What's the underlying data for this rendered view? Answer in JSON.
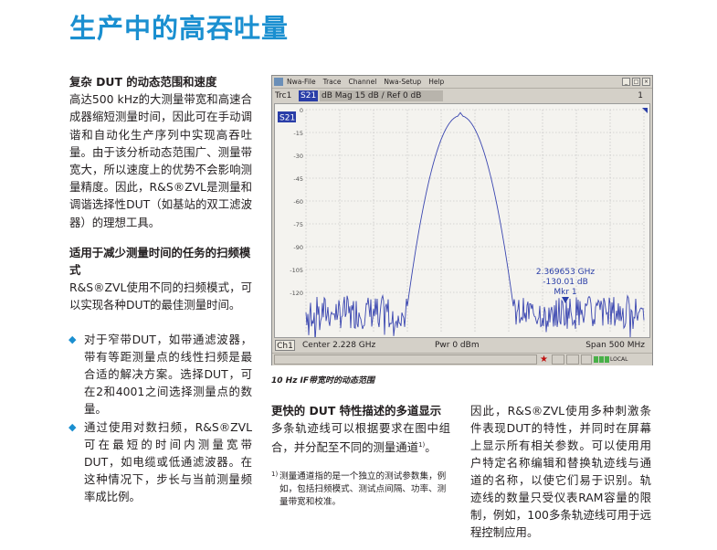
{
  "page": {
    "title": "生产中的高吞吐量"
  },
  "left_column": {
    "section1_heading": "复杂 DUT 的动态范围和速度",
    "section1_text": "高达500 kHz的大测量带宽和高速合成器缩短测量时间，因此可在手动调谐和自动化生产序列中实现高吞吐量。由于该分析动态范围广、测量带宽大，所以速度上的优势不会影响测量精度。因此，R&S®ZVL是测量和调谐选择性DUT（如基站的双工滤波器）的理想工具。",
    "section2_heading": "适用于减少测量时间的任务的扫频模式",
    "section2_text": "R&S®ZVL使用不同的扫频模式，可以实现各种DUT的最佳测量时间。",
    "bullets": [
      "对于窄带DUT，如带通滤波器，带有等距测量点的线性扫频是最合适的解决方案。选择DUT，可在2和4001之间选择测量点的数量。",
      "通过使用对数扫频，R&S®ZVL可在最短的时间内测量宽带DUT，如电缆或低通滤波器。在这种情况下，步长与当前测量频率成比例。"
    ]
  },
  "instrument": {
    "menu": [
      "Nwa-File",
      "Trace",
      "Channel",
      "Nwa-Setup",
      "Help"
    ],
    "trace_label": "Trc1",
    "trace_param": "S21",
    "trace_format": "dB Mag  15 dB /  Ref 0 dB",
    "trace_index": "1",
    "plot_tag": "S21",
    "y_ticks": [
      "0",
      "-15",
      "-30",
      "-45",
      "-60",
      "-75",
      "-90",
      "-105",
      "-120"
    ],
    "marker_freq": "2.369653 GHz",
    "marker_level": "-130.01 dB",
    "marker_name": "Mkr 1",
    "channel_label": "Ch1",
    "center": "Center  2.228 GHz",
    "power": "Pwr  0 dBm",
    "span": "Span  500 MHz",
    "status_local": "LOCAL",
    "colors": {
      "trace": "#3a46b0",
      "marker": "#2a3ea8",
      "grid": "#b8b8b8"
    }
  },
  "caption": "10 Hz IF带宽时的动态范围",
  "middle_column": {
    "heading": "更快的 DUT 特性描述的多道显示",
    "text_before_sup": "多条轨迹线可以根据要求在图中组合，并分配至不同的测量通道",
    "sup": "1)",
    "text_after_sup": "。",
    "footnote_mark": "1)",
    "footnote": "测量通道指的是一个独立的测试参数集，例如，包括扫频模式、测试点间隔、功率、测量带宽和校准。"
  },
  "right_column": {
    "text": "因此，R&S®ZVL使用多种刺激条件表现DUT的特性，并同时在屏幕上显示所有相关参数。可以使用用户特定名称编辑和替换轨迹线与通道的名称，以使它们易于识别。轨迹线的数量只受仪表RAM容量的限制，例如，100多条轨迹线可用于远程控制应用。"
  }
}
